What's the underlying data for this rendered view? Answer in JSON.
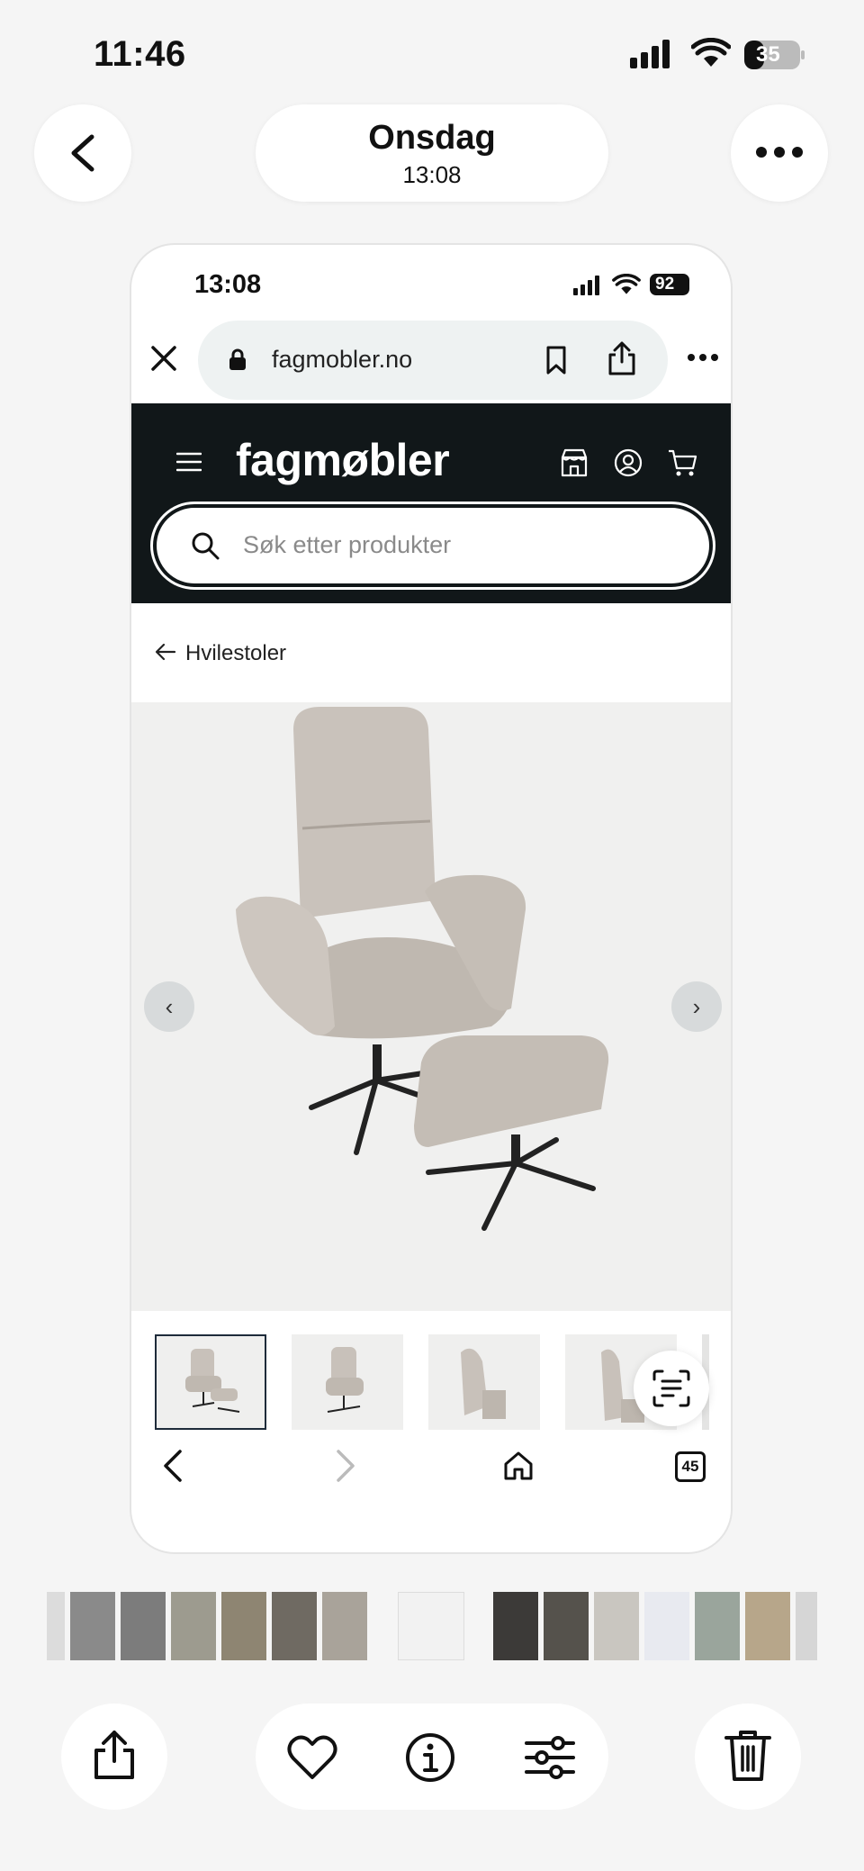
{
  "status_bar": {
    "time": "11:46",
    "battery": "35"
  },
  "header": {
    "day": "Onsdag",
    "time": "13:08"
  },
  "screenshot": {
    "status_bar": {
      "time": "13:08",
      "battery": "92"
    },
    "browser": {
      "url": "fagmobler.no",
      "tab_count": "45"
    },
    "site": {
      "logo": "fagmøbler",
      "search_placeholder": "Søk etter produkter",
      "breadcrumb": "Hvilestoler"
    }
  },
  "colors": {
    "site_header": "#111719",
    "background": "#f5f5f5",
    "accent_border": "#1e2b3a"
  }
}
